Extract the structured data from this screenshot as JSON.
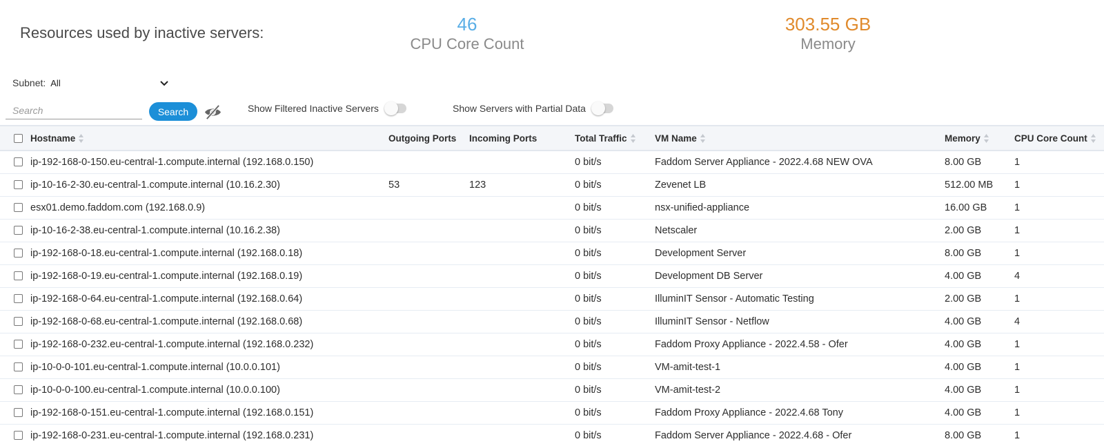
{
  "summary": {
    "title": "Resources used by inactive servers:",
    "cpu_value": "46",
    "cpu_label": "CPU Core Count",
    "memory_value": "303.55 GB",
    "memory_label": "Memory"
  },
  "filters": {
    "subnet_label": "Subnet:",
    "subnet_value": "All",
    "search_placeholder": "Search",
    "search_button": "Search",
    "toggle_filtered": "Show Filtered Inactive Servers",
    "toggle_partial": "Show Servers with Partial Data"
  },
  "colors": {
    "accent": "#1c8fd8",
    "cpu": "#5aaee6",
    "memory": "#e08a2c"
  },
  "table": {
    "headers": {
      "hostname": "Hostname",
      "outgoing": "Outgoing Ports",
      "incoming": "Incoming Ports",
      "traffic": "Total Traffic",
      "vm": "VM Name",
      "memory": "Memory",
      "cpu": "CPU Core Count"
    },
    "rows": [
      {
        "hostname": "ip-192-168-0-150.eu-central-1.compute.internal (192.168.0.150)",
        "outgoing": "",
        "incoming": "",
        "traffic": "0 bit/s",
        "vm": "Faddom Server Appliance - 2022.4.68 NEW OVA",
        "memory": "8.00 GB",
        "cpu": "1"
      },
      {
        "hostname": "ip-10-16-2-30.eu-central-1.compute.internal (10.16.2.30)",
        "outgoing": "53",
        "incoming": "123",
        "traffic": "0 bit/s",
        "vm": "Zevenet LB",
        "memory": "512.00 MB",
        "cpu": "1"
      },
      {
        "hostname": "esx01.demo.faddom.com (192.168.0.9)",
        "outgoing": "",
        "incoming": "",
        "traffic": "0 bit/s",
        "vm": "nsx-unified-appliance",
        "memory": "16.00 GB",
        "cpu": "1"
      },
      {
        "hostname": "ip-10-16-2-38.eu-central-1.compute.internal (10.16.2.38)",
        "outgoing": "",
        "incoming": "",
        "traffic": "0 bit/s",
        "vm": "Netscaler",
        "memory": "2.00 GB",
        "cpu": "1"
      },
      {
        "hostname": "ip-192-168-0-18.eu-central-1.compute.internal (192.168.0.18)",
        "outgoing": "",
        "incoming": "",
        "traffic": "0 bit/s",
        "vm": "Development Server",
        "memory": "8.00 GB",
        "cpu": "1"
      },
      {
        "hostname": "ip-192-168-0-19.eu-central-1.compute.internal (192.168.0.19)",
        "outgoing": "",
        "incoming": "",
        "traffic": "0 bit/s",
        "vm": "Development DB Server",
        "memory": "4.00 GB",
        "cpu": "4"
      },
      {
        "hostname": "ip-192-168-0-64.eu-central-1.compute.internal (192.168.0.64)",
        "outgoing": "",
        "incoming": "",
        "traffic": "0 bit/s",
        "vm": "IlluminIT Sensor - Automatic Testing",
        "memory": "2.00 GB",
        "cpu": "1"
      },
      {
        "hostname": "ip-192-168-0-68.eu-central-1.compute.internal (192.168.0.68)",
        "outgoing": "",
        "incoming": "",
        "traffic": "0 bit/s",
        "vm": "IlluminIT Sensor - Netflow",
        "memory": "4.00 GB",
        "cpu": "4"
      },
      {
        "hostname": "ip-192-168-0-232.eu-central-1.compute.internal (192.168.0.232)",
        "outgoing": "",
        "incoming": "",
        "traffic": "0 bit/s",
        "vm": "Faddom Proxy Appliance - 2022.4.58 - Ofer",
        "memory": "4.00 GB",
        "cpu": "1"
      },
      {
        "hostname": "ip-10-0-0-101.eu-central-1.compute.internal (10.0.0.101)",
        "outgoing": "",
        "incoming": "",
        "traffic": "0 bit/s",
        "vm": "VM-amit-test-1",
        "memory": "4.00 GB",
        "cpu": "1"
      },
      {
        "hostname": "ip-10-0-0-100.eu-central-1.compute.internal (10.0.0.100)",
        "outgoing": "",
        "incoming": "",
        "traffic": "0 bit/s",
        "vm": "VM-amit-test-2",
        "memory": "4.00 GB",
        "cpu": "1"
      },
      {
        "hostname": "ip-192-168-0-151.eu-central-1.compute.internal (192.168.0.151)",
        "outgoing": "",
        "incoming": "",
        "traffic": "0 bit/s",
        "vm": "Faddom Proxy Appliance - 2022.4.68 Tony",
        "memory": "4.00 GB",
        "cpu": "1"
      },
      {
        "hostname": "ip-192-168-0-231.eu-central-1.compute.internal (192.168.0.231)",
        "outgoing": "",
        "incoming": "",
        "traffic": "0 bit/s",
        "vm": "Faddom Server Appliance - 2022.4.68 - Ofer",
        "memory": "8.00 GB",
        "cpu": "1"
      }
    ]
  }
}
